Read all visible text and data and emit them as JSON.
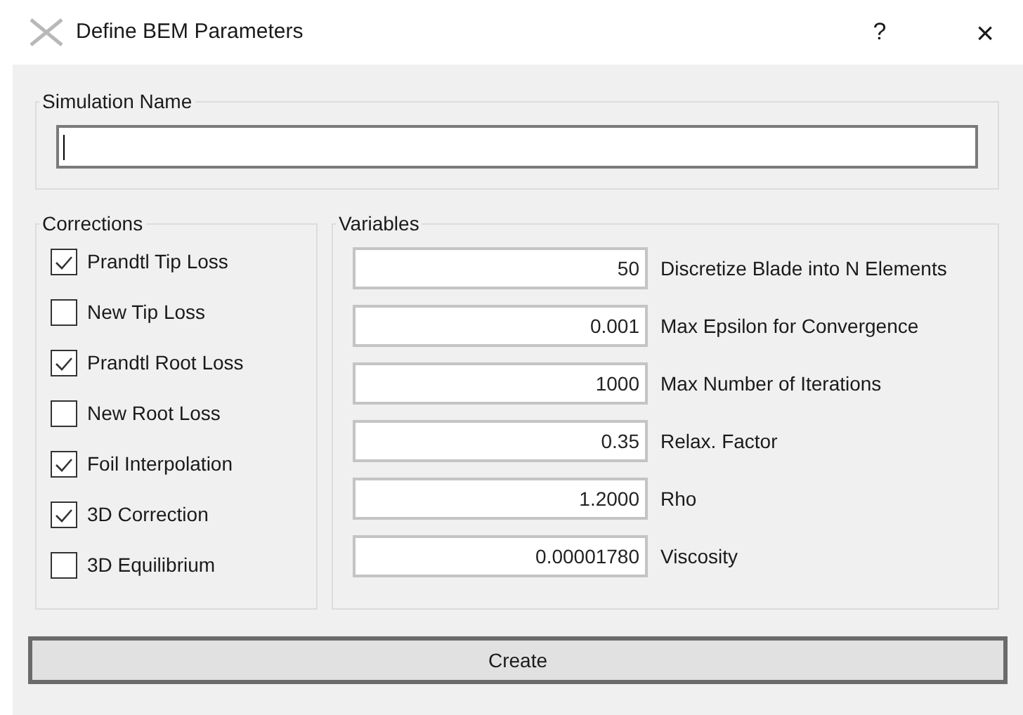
{
  "window": {
    "title": "Define BEM Parameters",
    "help": "?",
    "close": "×"
  },
  "simulation_name": {
    "legend": "Simulation Name"
  },
  "corrections": {
    "legend": "Corrections",
    "items": [
      {
        "label": "Prandtl Tip Loss",
        "checked": true
      },
      {
        "label": "New Tip Loss",
        "checked": false
      },
      {
        "label": "Prandtl Root Loss",
        "checked": true
      },
      {
        "label": "New Root Loss",
        "checked": false
      },
      {
        "label": "Foil Interpolation",
        "checked": true
      },
      {
        "label": "3D Correction",
        "checked": true
      },
      {
        "label": "3D Equilibrium",
        "checked": false
      }
    ]
  },
  "variables": {
    "legend": "Variables",
    "items": [
      {
        "value": "50",
        "label": "Discretize Blade into N Elements"
      },
      {
        "value": "0.001",
        "label": "Max Epsilon for Convergence"
      },
      {
        "value": "1000",
        "label": "Max Number of Iterations"
      },
      {
        "value": "0.35",
        "label": "Relax. Factor"
      },
      {
        "value": "1.2000",
        "label": "Rho"
      },
      {
        "value": "0.00001780",
        "label": "Viscosity"
      }
    ]
  },
  "create_button": "Create"
}
